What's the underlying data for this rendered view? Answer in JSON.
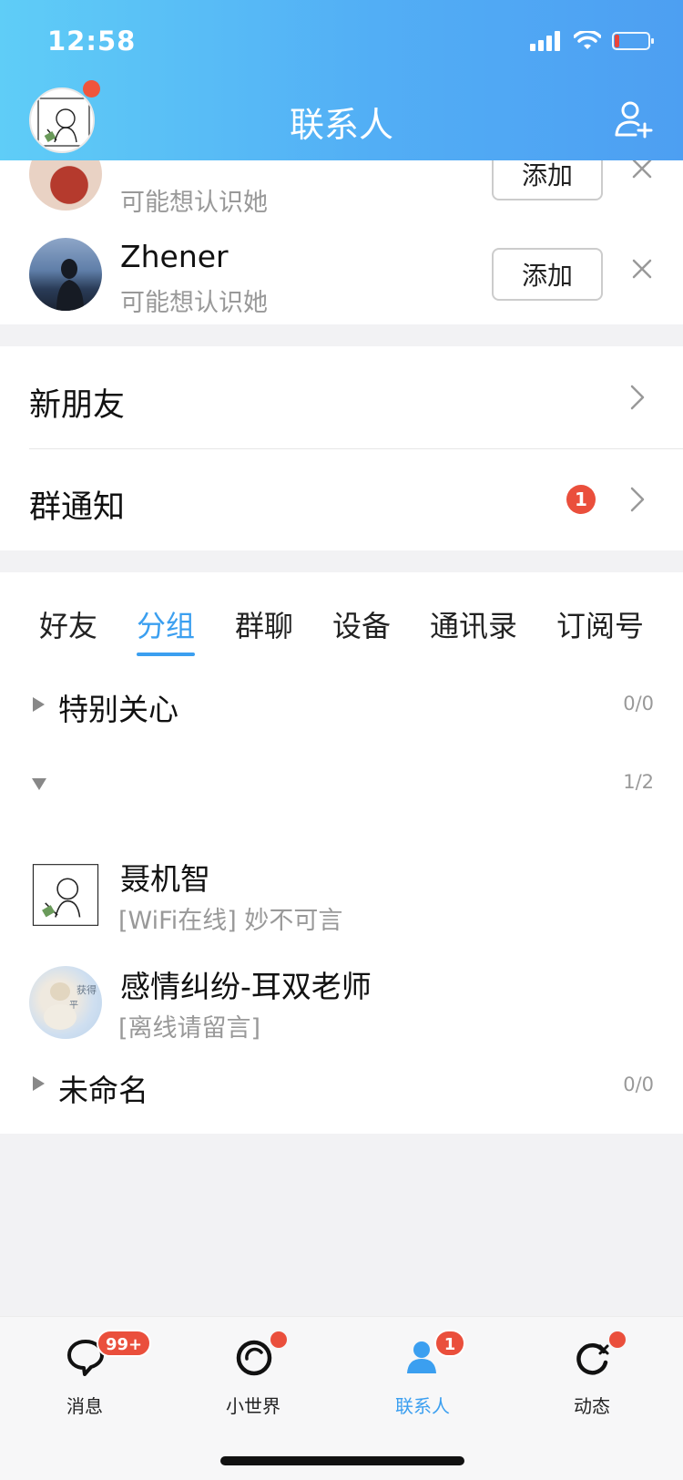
{
  "status_bar": {
    "time": "12:58"
  },
  "header": {
    "title": "联系人",
    "add_contact_icon": "person-add-icon"
  },
  "suggestions": [
    {
      "name": "",
      "subtitle": "可能想认识她",
      "action": "添加"
    },
    {
      "name": "Zhener",
      "subtitle": "可能想认识她",
      "action": "添加"
    }
  ],
  "menu": [
    {
      "label": "新朋友",
      "badge": ""
    },
    {
      "label": "群通知",
      "badge": "1"
    }
  ],
  "tabs": [
    "好友",
    "分组",
    "群聊",
    "设备",
    "通讯录",
    "订阅号"
  ],
  "active_tab": "分组",
  "groups": [
    {
      "name": "特别关心",
      "count": "0/0",
      "expanded": false
    },
    {
      "name": "",
      "count": "1/2",
      "expanded": true,
      "members": [
        {
          "name": "聂机智",
          "status": "[WiFi在线] 妙不可言"
        },
        {
          "name": "感情纠纷-耳双老师",
          "status": "[离线请留言]"
        }
      ]
    },
    {
      "name": "未命名",
      "count": "0/0",
      "expanded": false
    }
  ],
  "tabbar": [
    {
      "label": "消息",
      "icon": "chat-bubble-icon",
      "badge": "99+"
    },
    {
      "label": "小世界",
      "icon": "world-ring-icon",
      "badge": "dot"
    },
    {
      "label": "联系人",
      "icon": "contacts-icon",
      "badge": "1",
      "active": true
    },
    {
      "label": "动态",
      "icon": "refresh-star-icon",
      "badge": "dot"
    }
  ],
  "colors": {
    "accent": "#3b9ff0",
    "badge": "#ea4f3c",
    "header_start": "#5fcdf7",
    "header_end": "#4d9ff2"
  }
}
